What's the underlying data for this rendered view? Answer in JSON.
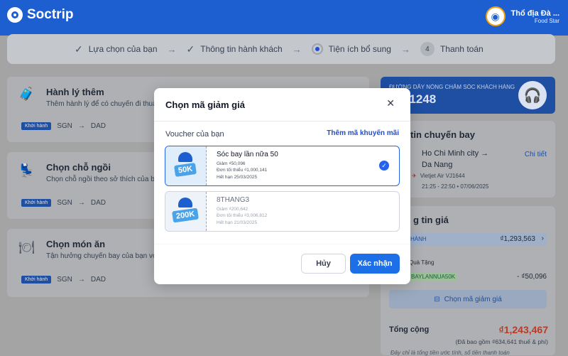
{
  "header": {
    "brand": "Soctrip",
    "user_name": "Thổ địa Đà ...",
    "user_sub": "Food Star"
  },
  "steps": [
    {
      "label": "Lựa chọn của bạn",
      "state": "done"
    },
    {
      "label": "Thông tin hành khách",
      "state": "done"
    },
    {
      "label": "Tiện ích bổ sung",
      "state": "current"
    },
    {
      "label": "Thanh toán",
      "state": "pending",
      "number": "4"
    }
  ],
  "cards": {
    "baggage": {
      "title": "Hành lý thêm",
      "desc": "Thêm hành lý để có chuyến đi thuận ti"
    },
    "seat": {
      "title": "Chọn chỗ ngồi",
      "desc": "Chọn chỗ ngồi theo sở thích của bạ"
    },
    "meal": {
      "title": "Chọn món ăn",
      "desc": "Tận hưởng chuyến bay của bạn với"
    },
    "route": {
      "badge": "Khởi hành",
      "from": "SGN",
      "to": "DAD"
    }
  },
  "hotline": {
    "label": "ĐƯỜNG DÂY NÓNG CHĂM SÓC KHÁCH HÀNG",
    "number": "0571248"
  },
  "flight": {
    "section_title": "tin chuyến bay",
    "from": "Ho Chi Minh city",
    "to": "Da Nang",
    "detail_link": "Chi tiết",
    "airline": "Vietjet Air VJ1644",
    "time": "21:25 - 22:50",
    "date": "07/06/2025"
  },
  "price": {
    "section_title": "g tin giá",
    "depart_label": "HÀNH",
    "depart_value": "₫1,293,563",
    "gift_label": "Quà Tặng",
    "gift_code": "BAYLANNUA50K",
    "gift_value": "- ₫50,096",
    "choose_voucher": "Chọn mã giảm giá",
    "total_label": "Tổng cộng",
    "total_value": "₫1,243,467",
    "tax_note": "(Đã bao gồm ₫634,641 thuế & phí)",
    "footnote": "Đây chỉ là tổng tiền ước tính, số tiền thanh toán"
  },
  "modal": {
    "title": "Chọn mã giảm giá",
    "section_label": "Voucher của bạn",
    "add_code": "Thêm mã khuyến mãi",
    "vouchers": [
      {
        "name": "Sóc bay lần nữa 50",
        "discount": "Giảm ₫50,096",
        "min_order": "Đơn tối thiểu ₫1,000,141",
        "expiry": "Hết hạn 25/03/2025",
        "tag": "50K",
        "selected": true
      },
      {
        "name": "8THANG3",
        "discount": "Giảm ₫200,642",
        "min_order": "Đơn tối thiểu ₫3,006,812",
        "expiry": "Hết hạn 21/03/2025",
        "tag": "200K",
        "selected": false
      }
    ],
    "cancel": "Hủy",
    "confirm": "Xác nhận"
  },
  "colors": {
    "primary": "#1d6fe8",
    "brand": "#1d5fd0",
    "price_red": "#c2412d"
  }
}
